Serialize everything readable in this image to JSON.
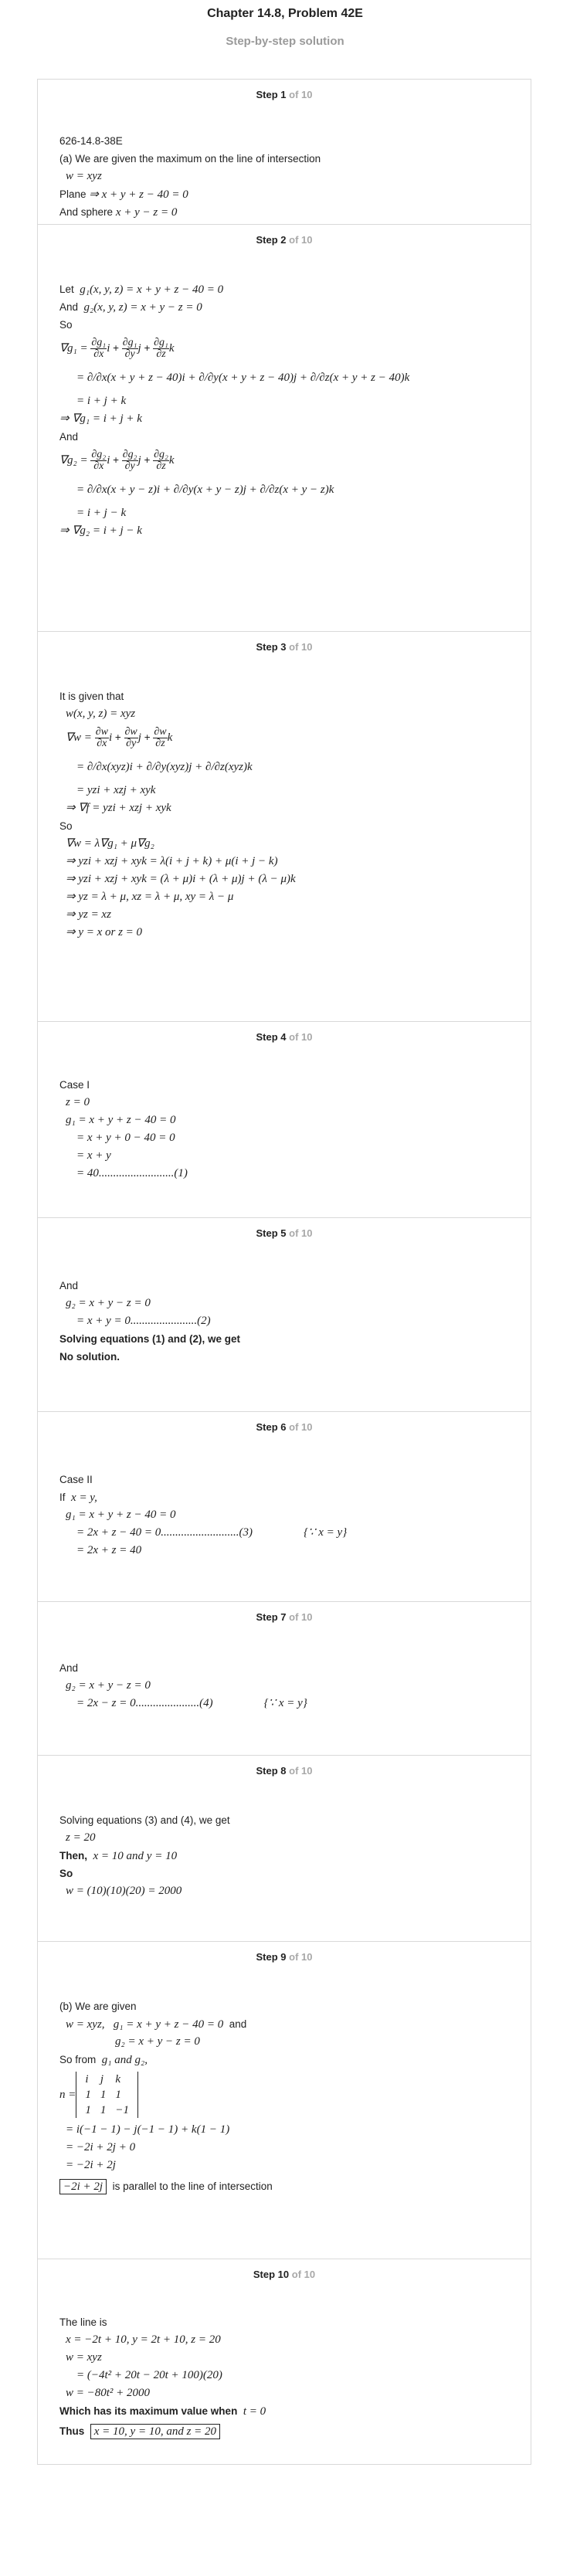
{
  "header": {
    "title": "Chapter 14.8, Problem 42E",
    "subtitle": "Step-by-step solution"
  },
  "step_of": "of 10",
  "steps": [
    {
      "label": "Step 1",
      "lines": [
        "626-14.8-38E",
        "(a) We are given the maximum on the line of intersection",
        "w = xyz",
        "Plane",
        "⇒ x + y + z − 40 = 0",
        "And sphere",
        "x + y − z = 0"
      ]
    },
    {
      "label": "Step 2",
      "lines": [
        "Let",
        "g₁(x, y, z) = x + y + z − 40 = 0",
        "And",
        "g₂(x, y, z) = x + y − z = 0",
        "So",
        "∇g₁ =",
        "= ∂/∂x(x + y + z − 40)i + ∂/∂y(x + y + z − 40)j + ∂/∂z(x + y + z − 40)k",
        "= i + j + k",
        "⇒ ∇g₁ = i + j + k",
        "And",
        "∇g₂ =",
        "= ∂/∂x(x + y − z)i + ∂/∂y(x + y − z)j + ∂/∂z(x + y − z)k",
        "= i + j − k",
        "⇒ ∇g₂ = i + j − k"
      ]
    },
    {
      "label": "Step 3",
      "lines": [
        "It is given that",
        "w(x, y, z) = xyz",
        "∇w =",
        "= ∂/∂x(xyz)i + ∂/∂y(xyz)j + ∂/∂z(xyz)k",
        "= yzi + xzj + xyk",
        "⇒ ∇f = yzi + xzj + xyk",
        "So",
        "∇w = λ∇g₁ + μ∇g₂",
        "⇒ yzi + xzj + xyk = λ(i + j + k) + μ(i + j − k)",
        "⇒ yzi + xzj + xyk = (λ + μ)i + (λ + μ)j + (λ − μ)k",
        "⇒ yz = λ + μ,   xz = λ + μ,   xy = λ − μ",
        "⇒ yz = xz",
        "⇒ y = x   or   z = 0"
      ]
    },
    {
      "label": "Step 4",
      "lines": [
        "Case I",
        "z = 0",
        "g₁ = x + y + z − 40 = 0",
        "= x + y + 0 − 40 = 0",
        "= x + y",
        "= 40..........................(1)"
      ]
    },
    {
      "label": "Step 5",
      "lines": [
        "And",
        "g₂ = x + y − z = 0",
        "= x + y = 0.......................(2)",
        "Solving equations (1) and (2), we get",
        "No solution."
      ]
    },
    {
      "label": "Step 6",
      "lines": [
        "Case II",
        "If",
        "x = y,",
        "g₁ = x + y + z − 40 = 0",
        "= 2x + z − 40 = 0...........................(3)",
        "{∵ x = y}",
        "= 2x + z = 40"
      ]
    },
    {
      "label": "Step 7",
      "lines": [
        "And",
        "g₂ = x + y − z = 0",
        "= 2x − z = 0......................(4)",
        "{∵ x = y}"
      ]
    },
    {
      "label": "Step 8",
      "lines": [
        "Solving equations (3) and (4), we get",
        "z = 20",
        "Then,",
        "x = 10 and y = 10",
        "So",
        "w = (10)(10)(20) = 2000"
      ]
    },
    {
      "label": "Step 9",
      "lines": [
        "(b) We are given",
        "w = xyz,",
        "g₁ = x + y + z − 40 = 0",
        "and",
        "g₂ = x + y − z = 0",
        "So from",
        "g₁ and g₂,",
        "n =",
        "= i(−1 − 1) − j(−1 − 1) + k(1 − 1)",
        "= −2i + 2j + 0",
        "= −2i + 2j",
        "−2i + 2j",
        "is parallel to the line of intersection"
      ],
      "matrix": [
        [
          "i",
          "j",
          "k"
        ],
        [
          "1",
          "1",
          "1"
        ],
        [
          "1",
          "1",
          "−1"
        ]
      ]
    },
    {
      "label": "Step 10",
      "lines": [
        "The line is",
        "x = −2t + 10,  y = 2t + 10,  z = 20",
        "w = xyz",
        "= (−4t² + 20t − 20t + 100)(20)",
        "w = −80t² + 2000",
        "Which has its maximum value when",
        "t = 0",
        "Thus",
        "x = 10,  y = 10,  and  z = 20"
      ]
    }
  ]
}
